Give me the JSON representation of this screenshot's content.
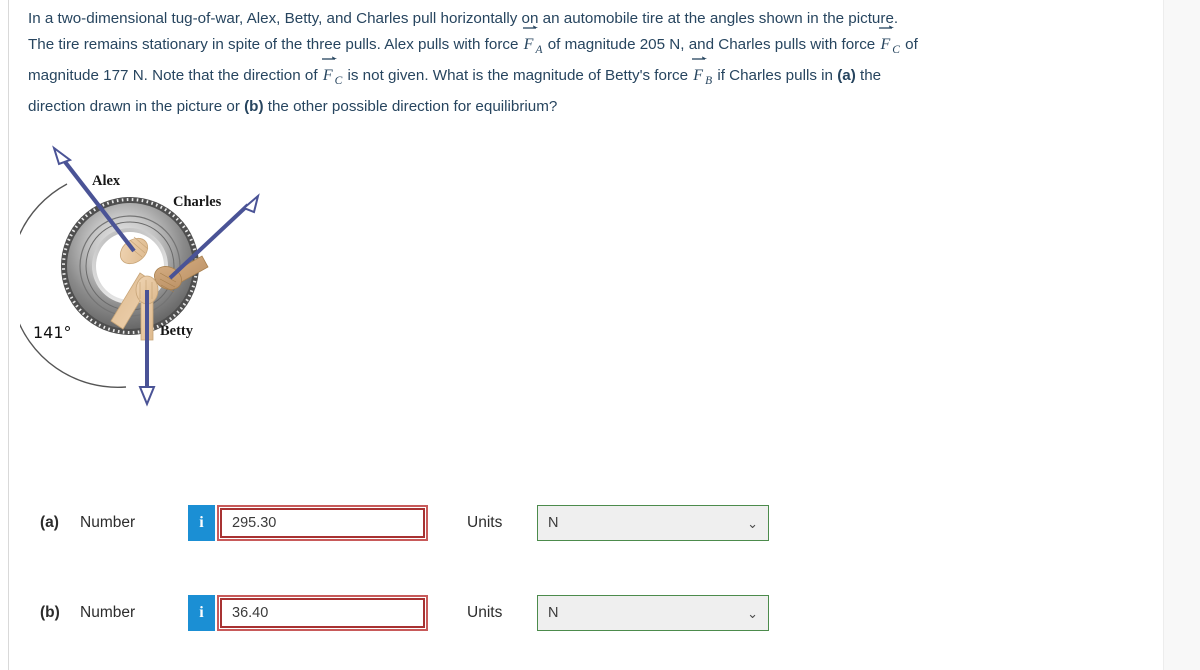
{
  "statement": {
    "line1_a": "In a two-dimensional tug-of-war, Alex, Betty, and Charles pull horizontally on an automobile tire at the angles shown in the picture.",
    "line2_a": "The tire remains stationary in spite of the three pulls. Alex pulls with force ",
    "line2_b": " of magnitude 205 N, and Charles pulls with force ",
    "line2_c": " of",
    "line3_a": "magnitude 177 N. Note that the direction of ",
    "line3_b": " is not given. What is the magnitude of Betty's force ",
    "line3_c": " if Charles pulls in ",
    "line3_bold_a": "(a)",
    "line3_d": " the",
    "line4_a": "direction drawn in the picture or ",
    "line4_bold_b": "(b)",
    "line4_b": " the other possible direction for equilibrium?",
    "symbol_F": "F",
    "sub_A": "A",
    "sub_B": "B",
    "sub_C": "C"
  },
  "figure": {
    "angle_label": "141°",
    "label_alex": "Alex",
    "label_charles": "Charles",
    "label_betty": "Betty",
    "arrow_color": "#4a5396",
    "tire_outer_color": "#6f6f6f",
    "tire_inner_color": "#c9c9c9",
    "arc_color": "#555555",
    "hand_color": "#e8c9a3",
    "hand_color_dark": "#c9a179"
  },
  "answers": {
    "rows": [
      {
        "part": "(a)",
        "number_label": "Number",
        "info_glyph": "i",
        "value": "295.30",
        "units_label": "Units",
        "units_value": "N",
        "chevron": "⌄"
      },
      {
        "part": "(b)",
        "number_label": "Number",
        "info_glyph": "i",
        "value": "36.40",
        "units_label": "Units",
        "units_value": "N",
        "chevron": "⌄"
      }
    ]
  },
  "colors": {
    "text": "#27455f",
    "info_button": "#1b8fd4",
    "input_border": "#a83232",
    "select_border": "#4c8b4c",
    "gutter": "#f8f8f8"
  }
}
